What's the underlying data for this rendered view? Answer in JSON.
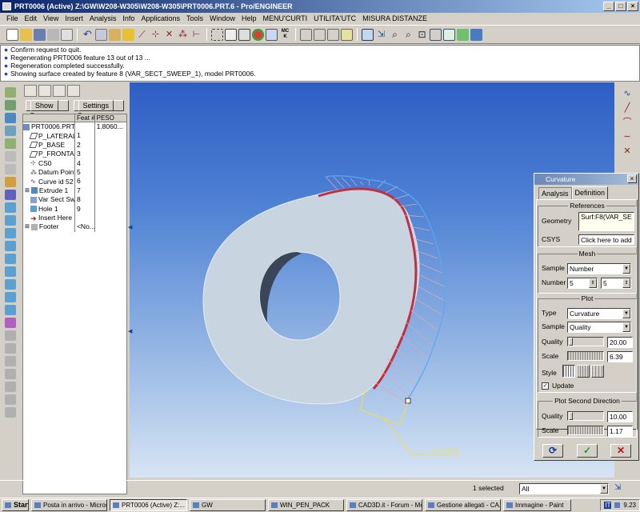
{
  "window": {
    "title": "PRT0006 (Active) Z:\\GW\\W208-W305\\W208-W305\\PRT0006.PRT.6 - Pro/ENGINEER"
  },
  "menubar": [
    "File",
    "Edit",
    "View",
    "Insert",
    "Analysis",
    "Info",
    "Applications",
    "Tools",
    "Window",
    "Help",
    "MENU'CURTI",
    "UTILITA'UTC",
    "MISURA DISTANZE"
  ],
  "messages": [
    "Confirm request to quit.",
    "Regenerating PRT0006 feature 13 out of 13 ...",
    "Regeneration completed successfully.",
    "Showing surface created by feature 8 (VAR_SECT_SWEEP_1), model PRT0006."
  ],
  "tree": {
    "show_label": "Show",
    "settings_label": "Settings",
    "columns": [
      "",
      "Feat #",
      "PESO"
    ],
    "rows": [
      {
        "name": "PRT0006.PRT",
        "feat": "",
        "peso": "1.8060..."
      },
      {
        "name": "P_LATERAL",
        "feat": "1",
        "peso": ""
      },
      {
        "name": "P_BASE",
        "feat": "2",
        "peso": ""
      },
      {
        "name": "P_FRONTAL",
        "feat": "3",
        "peso": ""
      },
      {
        "name": "CS0",
        "feat": "4",
        "peso": ""
      },
      {
        "name": "Datum Point",
        "feat": "5",
        "peso": ""
      },
      {
        "name": "Curve id 52",
        "feat": "6",
        "peso": ""
      },
      {
        "name": "Extrude 1",
        "feat": "7",
        "peso": ""
      },
      {
        "name": "Var Sect Sw",
        "feat": "8",
        "peso": ""
      },
      {
        "name": "Hole 1",
        "feat": "9",
        "peso": ""
      },
      {
        "name": "Insert Here",
        "feat": "",
        "peso": ""
      },
      {
        "name": "Footer",
        "feat": "<No...",
        "peso": ""
      }
    ]
  },
  "viewport": {
    "dimension_label": "1.17 ×10.0"
  },
  "curvature": {
    "title": "Curvature",
    "tabs": [
      "Analysis",
      "Definition"
    ],
    "references_label": "References",
    "geometry_label": "Geometry",
    "geometry_value": "Surf:F8(VAR_SE",
    "csys_label": "CSYS",
    "csys_value": "Click here to add",
    "mesh_label": "Mesh",
    "mesh_sample_label": "Sample",
    "mesh_sample_value": "Number",
    "number_label": "Number",
    "number_u": "5",
    "number_v": "5",
    "plot_label": "Plot",
    "type_label": "Type",
    "type_value": "Curvature",
    "plot_sample_label": "Sample",
    "plot_sample_value": "Quality",
    "quality_label": "Quality",
    "quality_value": "20.00",
    "scale_label": "Scale",
    "scale_value": "6.39",
    "style_label": "Style",
    "update_label": "Update",
    "second_label": "Plot Second Direction",
    "quality2_label": "Quality",
    "quality2_value": "10.00",
    "scale2_label": "Scale",
    "scale2_value": "1.17"
  },
  "status": {
    "selected": "1 selected",
    "filter": "All"
  },
  "taskbar": {
    "start": "Start",
    "tasks": [
      "Posta in arrivo - Micros...",
      "PRT0006 (Active) Z:...",
      "GW",
      "WIN_PEN_PACK",
      "CAD3D.it - Forum - Mo...",
      "Gestione allegati - CA...",
      "Immagine - Paint"
    ],
    "lang": "IT",
    "time": "9.23"
  }
}
